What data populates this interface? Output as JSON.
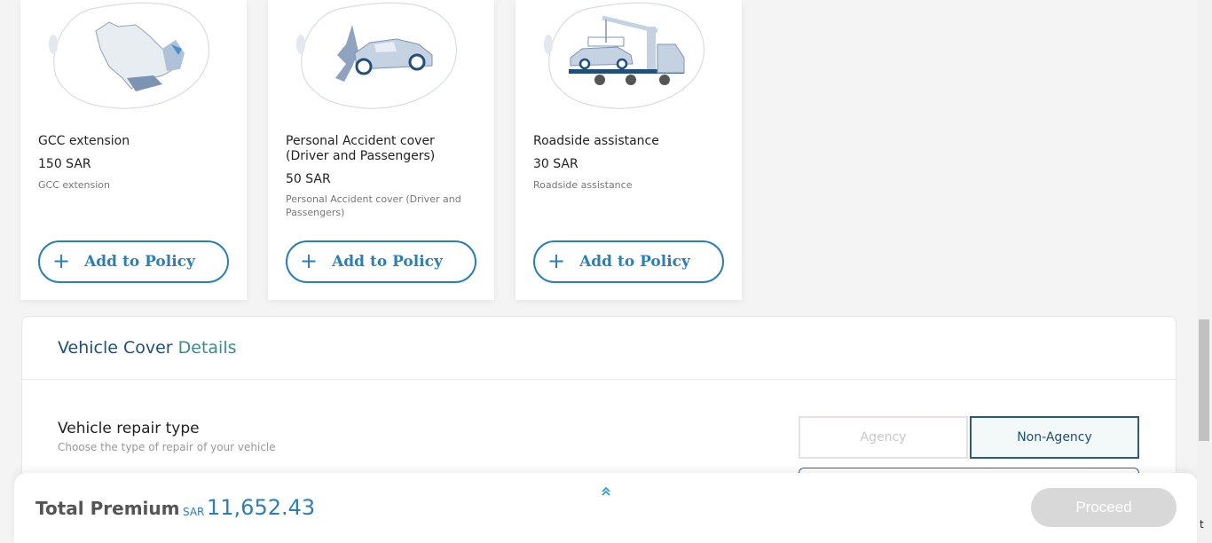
{
  "addons": [
    {
      "icon": "gcc-map-icon",
      "title": "GCC extension",
      "price": "150 SAR",
      "description": "GCC extension",
      "button_label": "Add to Policy"
    },
    {
      "icon": "car-accident-icon",
      "title": "Personal Accident cover (Driver and Passengers)",
      "price": "50 SAR",
      "description": "Personal Accident cover (Driver and Passengers)",
      "button_label": "Add to Policy"
    },
    {
      "icon": "tow-truck-icon",
      "title": "Roadside assistance",
      "price": "30 SAR",
      "description": "Roadside assistance",
      "button_label": "Add to Policy"
    }
  ],
  "vehicle_cover": {
    "title_part1": "Vehicle Cover",
    "title_part2": "Details",
    "repair_type_label": "Vehicle repair type",
    "repair_type_sub": "Choose the type of repair of your vehicle",
    "options": [
      "Agency",
      "Non-Agency"
    ],
    "selected": "Non-Agency"
  },
  "footer": {
    "total_label": "Total Premium",
    "currency": "SAR",
    "amount": "11,652.43",
    "proceed_label": "Proceed"
  },
  "edge_text": "t",
  "colors": {
    "primary": "#2b7fb8",
    "dark_blue": "#1f4f7a",
    "teal": "#3a8b8b",
    "disabled": "#d8d8d8"
  }
}
